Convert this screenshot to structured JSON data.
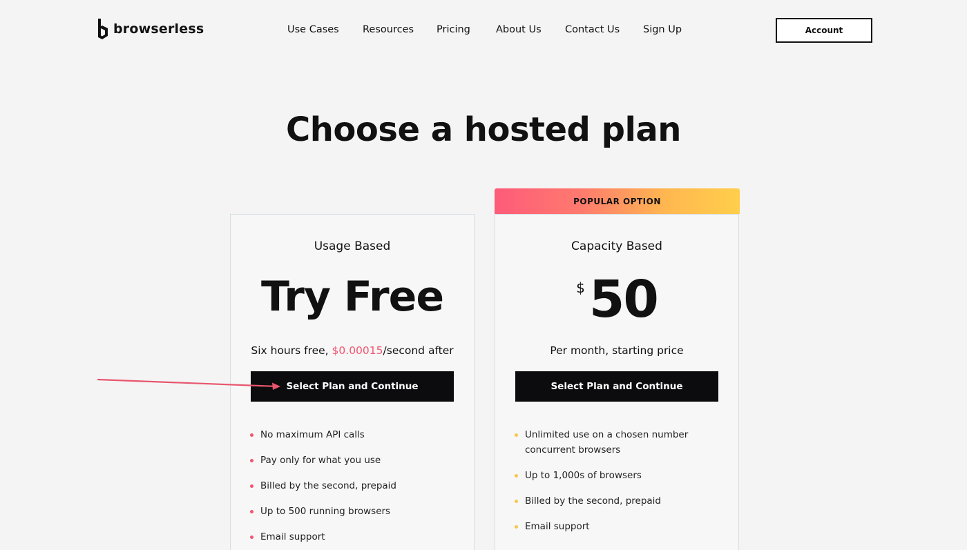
{
  "brand": {
    "name": "browserless"
  },
  "nav": {
    "items": [
      {
        "label": "Use Cases"
      },
      {
        "label": "Resources"
      },
      {
        "label": "Pricing"
      },
      {
        "label": "About Us"
      },
      {
        "label": "Contact Us"
      },
      {
        "label": "Sign Up"
      }
    ],
    "account_label": "Account"
  },
  "page_title": "Choose a hosted plan",
  "colors": {
    "accent_pink": "#f2556f",
    "accent_yellow": "#f5c84a",
    "button_dark": "#0c0b0d"
  },
  "plans": [
    {
      "name": "Usage Based",
      "headline": "Try Free",
      "subtitle_prefix": "Six hours free, ",
      "rate": "$0.00015",
      "subtitle_suffix": "/second after",
      "button_label": "Select Plan and Continue",
      "bullet_color": "pink",
      "features": [
        "No maximum API calls",
        "Pay only for what you use",
        "Billed by the second, prepaid",
        "Up to 500 running browsers",
        "Email support"
      ]
    },
    {
      "badge": "POPULAR OPTION",
      "name": "Capacity Based",
      "currency": "$",
      "price": "50",
      "subtitle": "Per month, starting price",
      "button_label": "Select Plan and Continue",
      "bullet_color": "yellow",
      "features": [
        "Unlimited use on a chosen number concurrent browsers",
        "Up to 1,000s of browsers",
        "Billed by the second, prepaid",
        "Email support"
      ]
    }
  ]
}
